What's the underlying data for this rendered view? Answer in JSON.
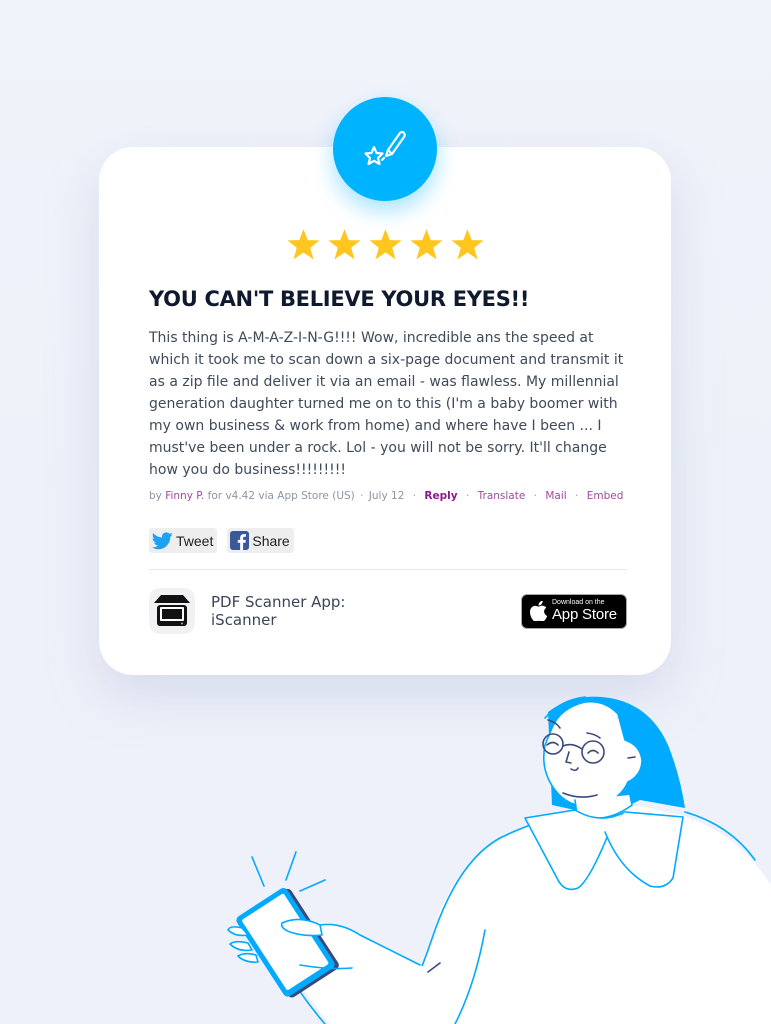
{
  "badge": {
    "icon": "star-pencil-icon",
    "color": "#00b3ff"
  },
  "review": {
    "rating": 5,
    "max_rating": 5,
    "star_color": "#ffc61f",
    "title": "YOU CAN'T BELIEVE YOUR EYES!!",
    "body": "This thing is A-M-A-Z-I-N-G!!!! Wow, incredible ans the speed at which it took me to scan down a six-page document and transmit it as a zip file and deliver it via an email - was flawless. My millennial generation daughter turned me on to this (I'm a baby boomer with my own business & work from home) and where have I been ... I must've been under a rock. Lol - you will not be sorry. It'll change how you do business!!!!!!!!!",
    "meta": {
      "by_prefix": "by",
      "author": "Finny P.",
      "details": "for v4.42 via App Store (US)",
      "separator": "·",
      "date": "July 12",
      "actions": {
        "reply": "Reply",
        "translate": "Translate",
        "mail": "Mail",
        "embed": "Embed"
      }
    }
  },
  "share": {
    "tweet_label": "Tweet",
    "share_label": "Share"
  },
  "app": {
    "name_line1": "PDF Scanner App:",
    "name_line2": "iScanner",
    "store_button": {
      "small_text": "Download on the",
      "big_text": "App Store"
    }
  },
  "illustration": {
    "description": "woman-holding-phone",
    "accent_color": "#00aaff"
  }
}
